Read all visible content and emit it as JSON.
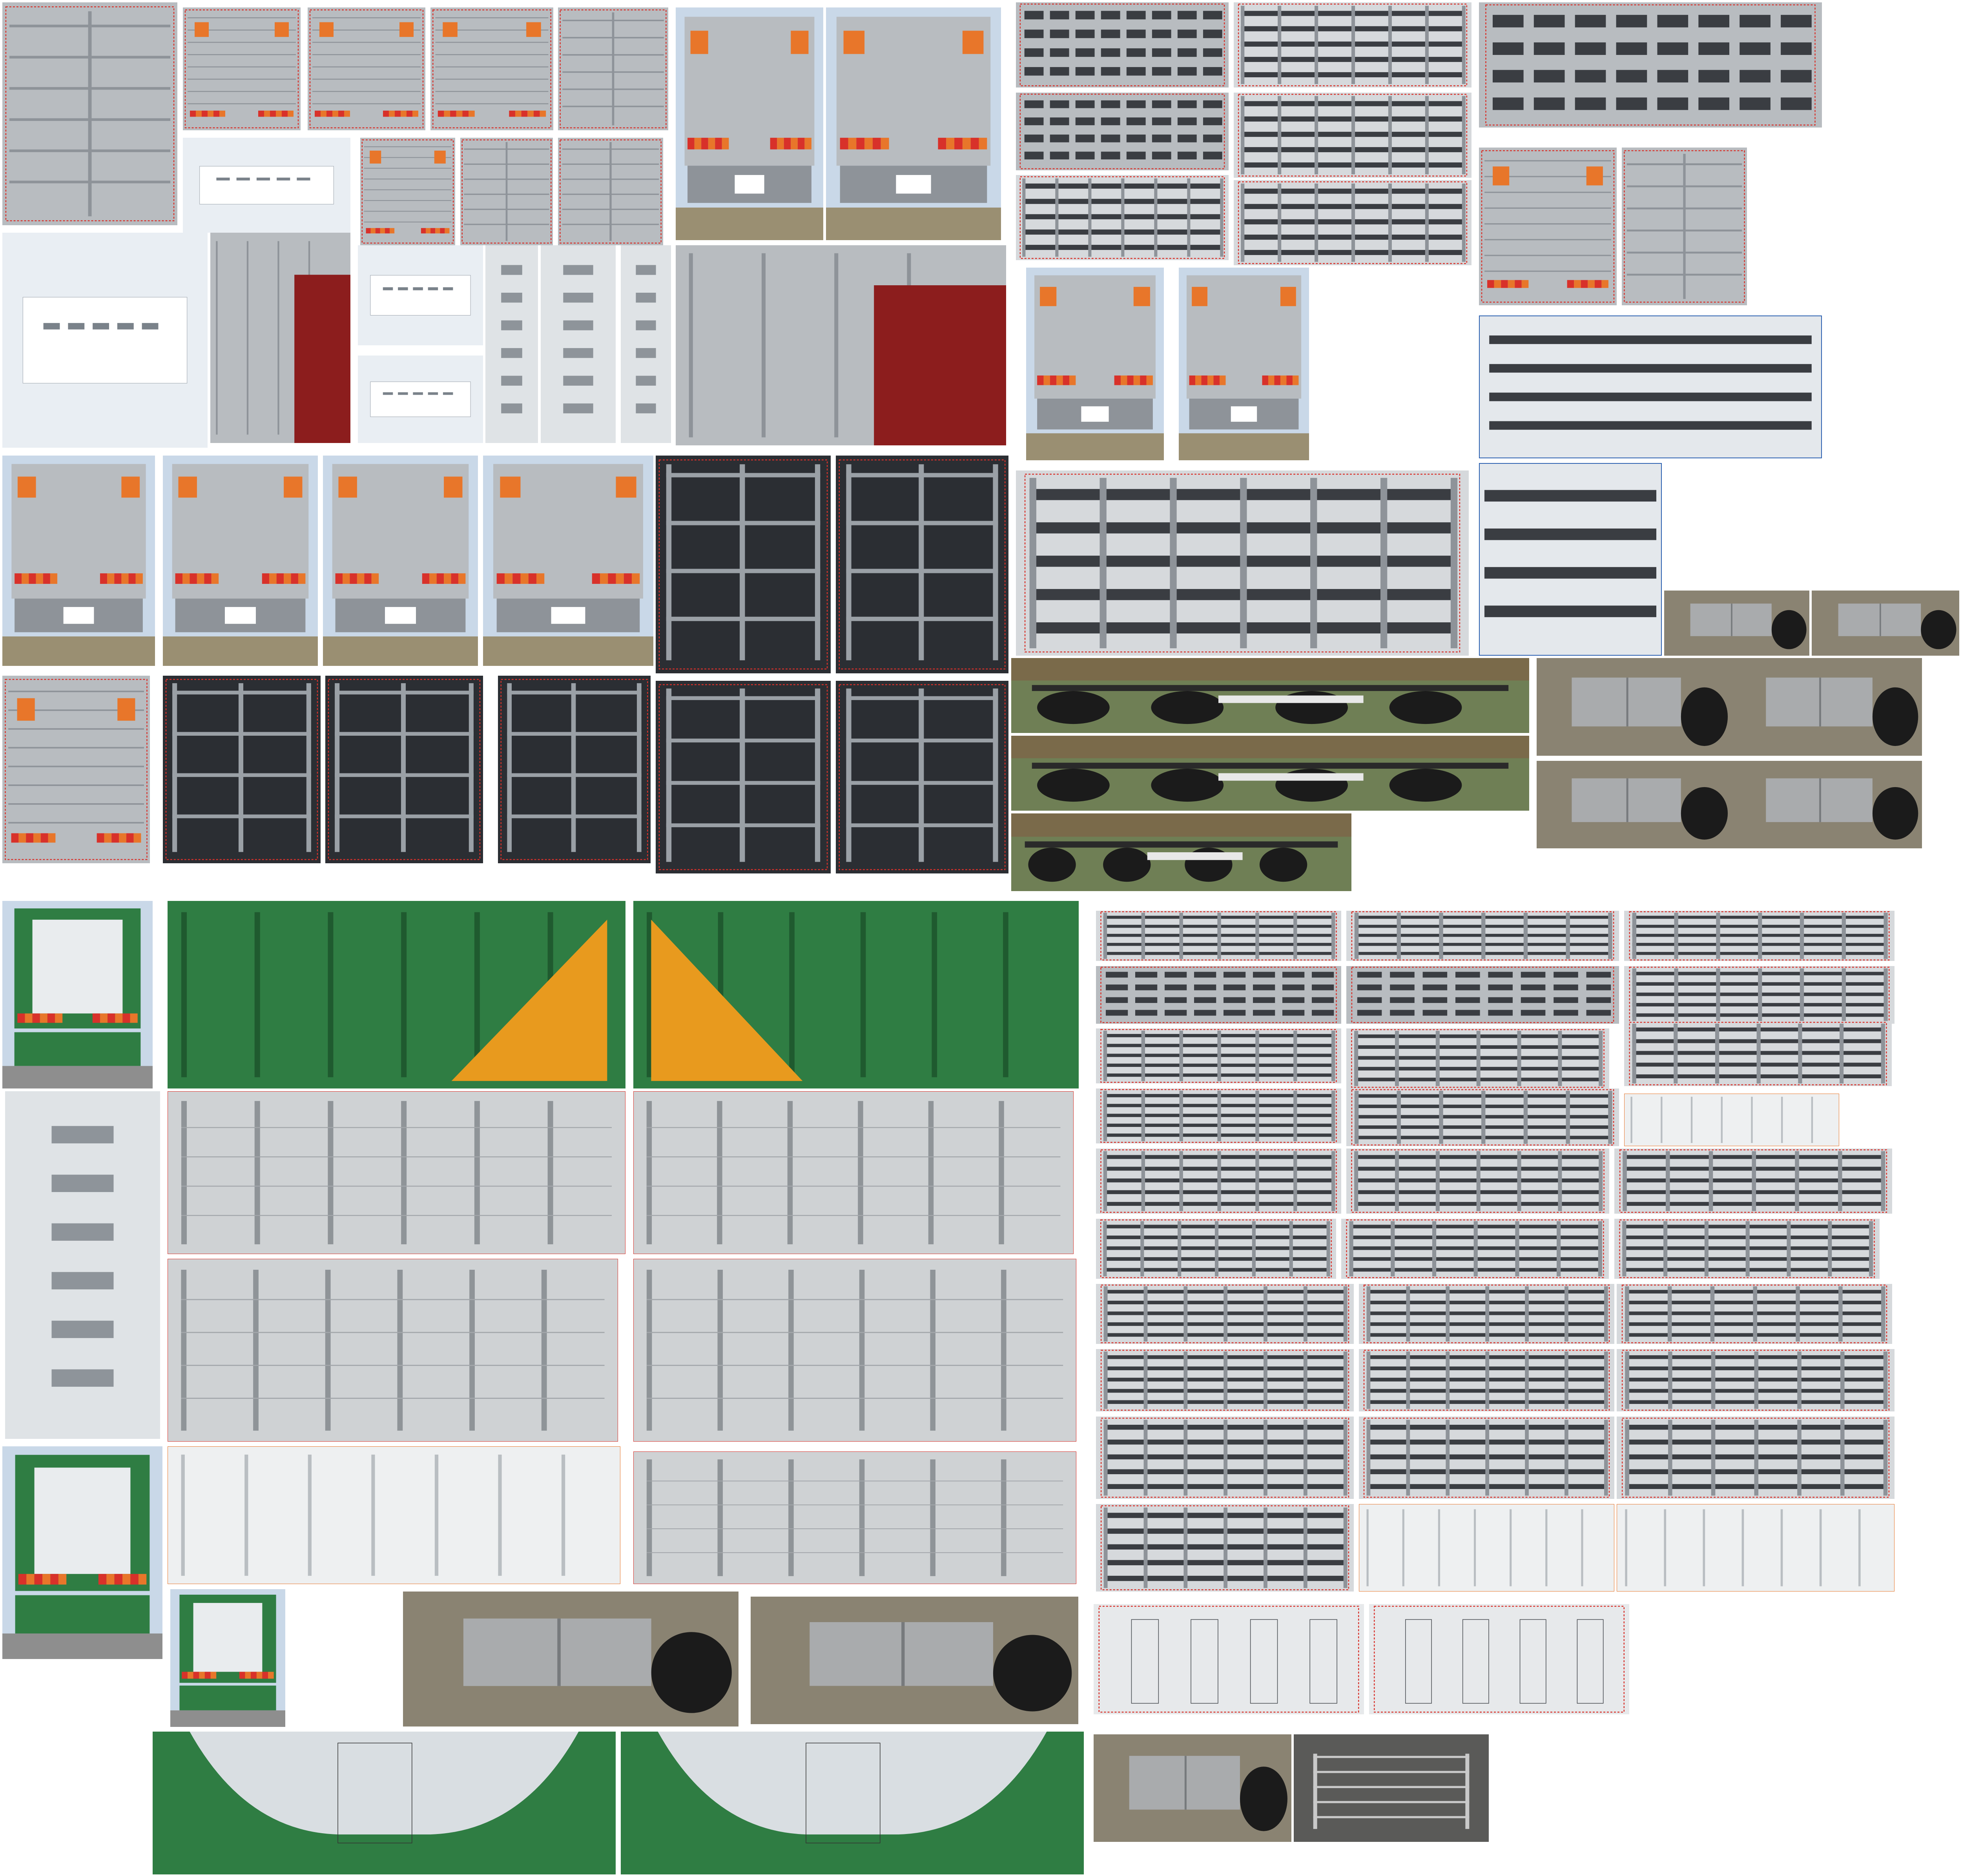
{
  "photo_grid": {
    "palette": {
      "background": "#ffffff",
      "aluminum": "#b8bcc0",
      "aluminum_dark": "#8e9399",
      "slot": "#3a3d42",
      "warning_red": "#d8312a",
      "warning_orange": "#e8762a",
      "body_green": "#2f7d43",
      "accent_orange": "#e89a1e",
      "white_panel": "#eef0f1",
      "cab_red": "#8c1d1d",
      "frame_blue": "#2a5fb0",
      "sky": "#c9d8e8",
      "ground": "#9a8f72"
    }
  }
}
